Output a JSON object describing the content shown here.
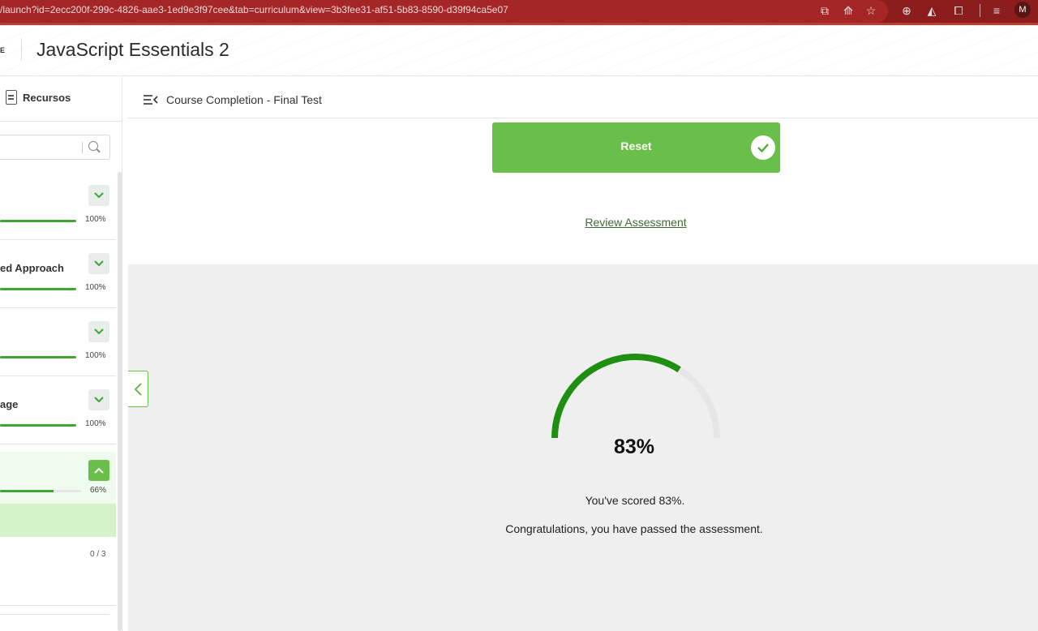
{
  "browser": {
    "url": "/launch?id=2ecc200f-299c-4826-aae3-1ed9e3f97cee&tab=curriculum&view=3b3fee31-af51-5b83-8590-d39f94ca5e07",
    "avatar_letter": "M"
  },
  "header": {
    "logo_fragment": "E",
    "course_title": "JavaScript Essentials 2"
  },
  "sidebar": {
    "tab_label": "Recursos",
    "modules": [
      {
        "label": "",
        "progress": 100,
        "progress_label": "100%"
      },
      {
        "label": "ed Approach",
        "progress": 100,
        "progress_label": "100%"
      },
      {
        "label": "",
        "progress": 100,
        "progress_label": "100%"
      },
      {
        "label": "age",
        "progress": 100,
        "progress_label": "100%"
      },
      {
        "label": "",
        "progress": 66,
        "progress_label": "66%"
      }
    ],
    "item_count": "0 / 3"
  },
  "main": {
    "breadcrumb_title": "Course Completion - Final Test",
    "reset_label": "Reset",
    "review_link": "Review Assessment",
    "score_value": 83,
    "score_big": "83%",
    "score_line": "You've scored 83%.",
    "congrats_line": "Congratulations, you have passed the assessment."
  },
  "colors": {
    "accent_green": "#6abf4b",
    "gauge_green": "#1f8f12",
    "browser_red": "#8c1d1d"
  }
}
